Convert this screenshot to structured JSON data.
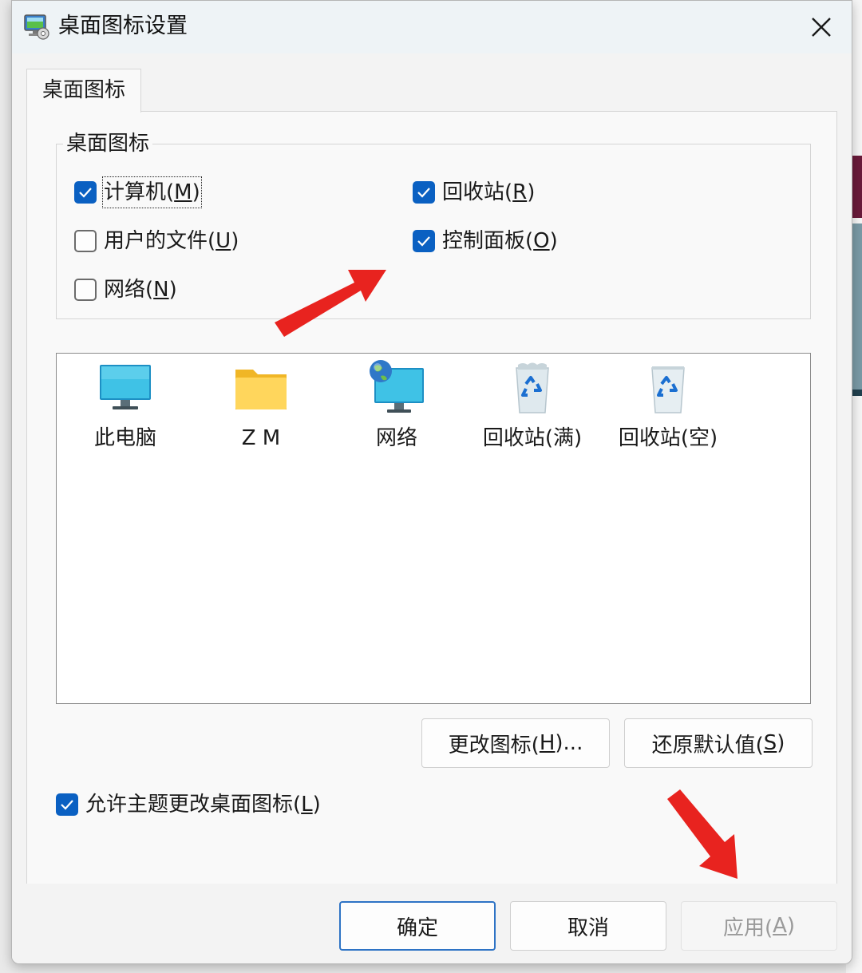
{
  "window": {
    "title": "桌面图标设置",
    "close_icon": "close-icon"
  },
  "tab": {
    "label": "桌面图标"
  },
  "group": {
    "legend": "桌面图标",
    "checkboxes": [
      {
        "text": "计算机(",
        "key": "M",
        "end": ")",
        "checked": true
      },
      {
        "text": "回收站(",
        "key": "R",
        "end": ")",
        "checked": true
      },
      {
        "text": "用户的文件(",
        "key": "U",
        "end": ")",
        "checked": false
      },
      {
        "text": "控制面板(",
        "key": "O",
        "end": ")",
        "checked": true
      },
      {
        "text": "网络(",
        "key": "N",
        "end": ")",
        "checked": false
      }
    ]
  },
  "icons": [
    {
      "label": "此电脑",
      "icon": "monitor-icon"
    },
    {
      "label": "Z M",
      "icon": "folder-icon"
    },
    {
      "label": "网络",
      "icon": "network-globe-icon"
    },
    {
      "label": "回收站(满)",
      "icon": "recycle-bin-full-icon"
    },
    {
      "label": "回收站(空)",
      "icon": "recycle-bin-empty-icon"
    }
  ],
  "buttons": {
    "change_icon": {
      "text": "更改图标(",
      "key": "H",
      "end": ")..."
    },
    "restore_default": {
      "text": "还原默认值(",
      "key": "S",
      "end": ")"
    },
    "ok": "确定",
    "cancel": "取消",
    "apply": {
      "text": "应用(",
      "key": "A",
      "end": ")"
    }
  },
  "allow_themes": {
    "text": "允许主题更改桌面图标(",
    "key": "L",
    "end": ")",
    "checked": true
  },
  "colors": {
    "accent": "#0a60c2",
    "annotation_arrow": "#e8231f"
  }
}
